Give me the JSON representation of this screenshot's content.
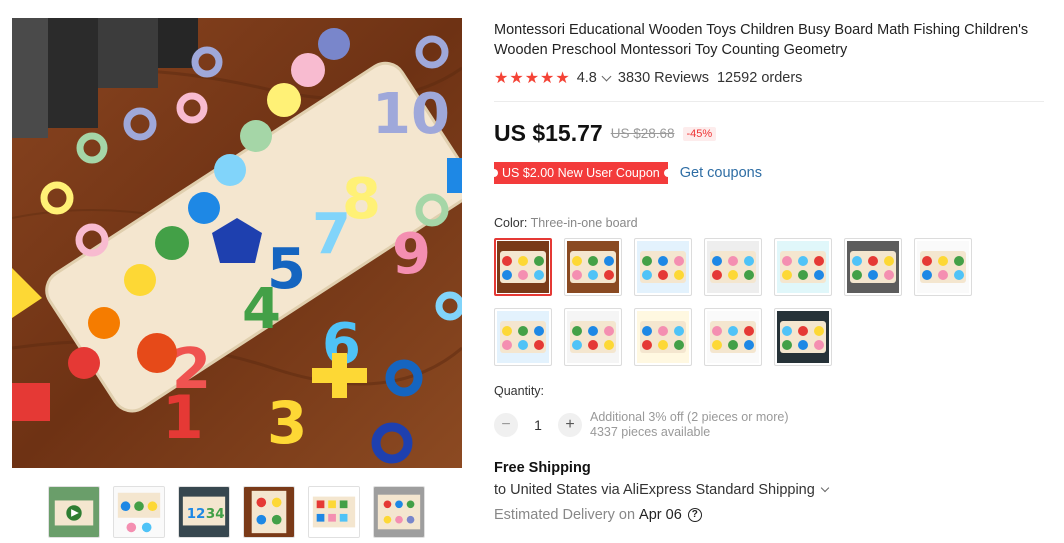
{
  "product": {
    "title": "Montessori Educational Wooden Toys Children Busy Board Math Fishing Children's Wooden Preschool Montessori Toy Counting Geometry",
    "stars": "★★★★★",
    "rating": "4.8",
    "reviews": "3830 Reviews",
    "orders": "12592 orders"
  },
  "price": {
    "current": "US $15.77",
    "original": "US $28.68",
    "discount": "-45%"
  },
  "coupon": {
    "badge": "US $2.00 New User Coupon",
    "link": "Get coupons"
  },
  "color": {
    "label": "Color:",
    "selected_value": "Three-in-one board",
    "swatch_count": 12,
    "selected_index": 0
  },
  "quantity": {
    "label": "Quantity:",
    "minus": "−",
    "value": "1",
    "plus": "+",
    "offer": "Additional 3% off (2 pieces or more)",
    "available": "4337 pieces available"
  },
  "shipping": {
    "title": "Free Shipping",
    "destination": "to United States via AliExpress Standard Shipping",
    "delivery_label": "Estimated Delivery on",
    "delivery_date": "Apr 06",
    "help_icon": "?"
  },
  "gallery": {
    "thumbnail_count": 6
  },
  "colors": {
    "accent_red": "#f33b3b",
    "link_blue": "#2e6da4",
    "star_red": "#f44336",
    "wood_brown": "#7a3a18"
  }
}
